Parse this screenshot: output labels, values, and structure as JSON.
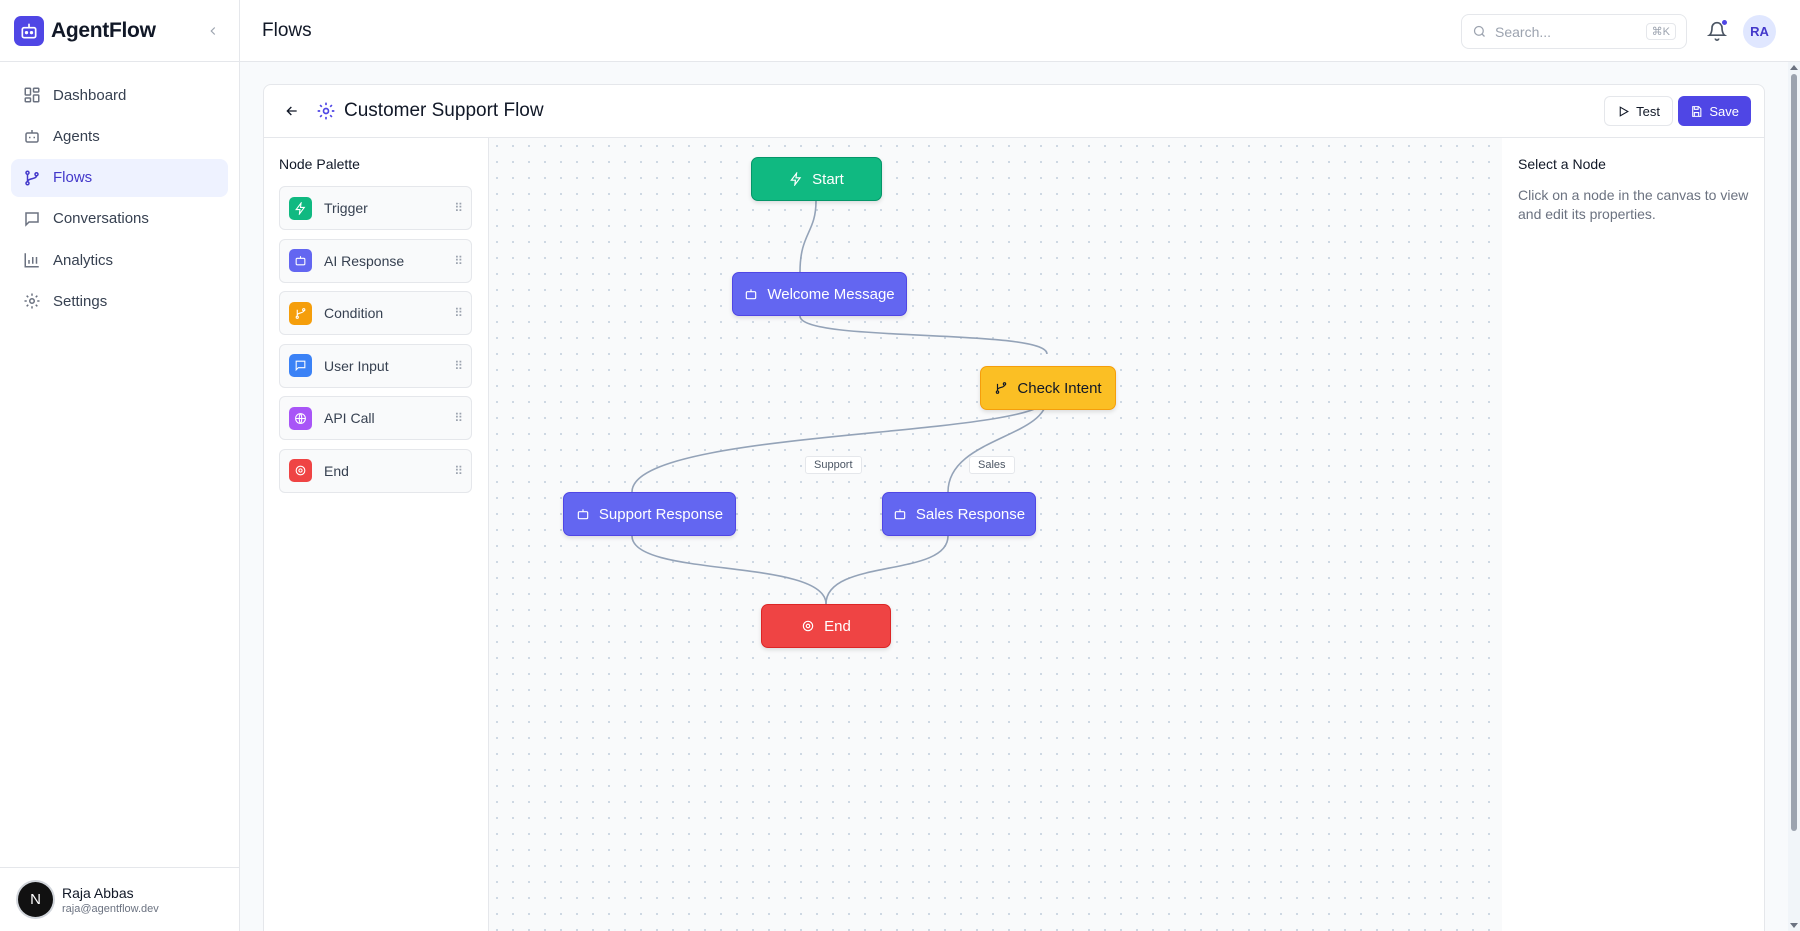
{
  "app": {
    "name": "AgentFlow"
  },
  "sidebar": {
    "items": [
      {
        "label": "Dashboard",
        "icon": "dashboard-icon",
        "active": false
      },
      {
        "label": "Agents",
        "icon": "bot-icon",
        "active": false
      },
      {
        "label": "Flows",
        "icon": "flow-icon",
        "active": true
      },
      {
        "label": "Conversations",
        "icon": "message-icon",
        "active": false
      },
      {
        "label": "Analytics",
        "icon": "chart-icon",
        "active": false
      },
      {
        "label": "Settings",
        "icon": "gear-icon",
        "active": false
      }
    ]
  },
  "user": {
    "initial": "N",
    "name": "Raja Abbas",
    "email": "raja@agentflow.dev"
  },
  "header": {
    "title": "Flows",
    "search_placeholder": "Search...",
    "shortcut": "⌘K",
    "avatar_initials": "RA",
    "has_notification": true
  },
  "editor": {
    "flow_name": "Customer Support Flow",
    "test_label": "Test",
    "save_label": "Save"
  },
  "palette": {
    "title": "Node Palette",
    "items": [
      {
        "label": "Trigger",
        "icon": "lightning-icon",
        "color": "#10b981"
      },
      {
        "label": "AI Response",
        "icon": "bot-icon",
        "color": "#6366f1"
      },
      {
        "label": "Condition",
        "icon": "branch-icon",
        "color": "#f59e0b"
      },
      {
        "label": "User Input",
        "icon": "message-icon",
        "color": "#3b82f6"
      },
      {
        "label": "API Call",
        "icon": "globe-icon",
        "color": "#a855f7"
      },
      {
        "label": "End",
        "icon": "target-icon",
        "color": "#ef4444"
      }
    ]
  },
  "canvas": {
    "nodes": [
      {
        "id": "start",
        "label": "Start",
        "type": "trigger",
        "color": "#10b981"
      },
      {
        "id": "welcome",
        "label": "Welcome Message",
        "type": "ai-response",
        "color": "#6366f1"
      },
      {
        "id": "check",
        "label": "Check Intent",
        "type": "condition",
        "color": "#fbbf24"
      },
      {
        "id": "support",
        "label": "Support Response",
        "type": "ai-response",
        "color": "#6366f1"
      },
      {
        "id": "sales",
        "label": "Sales Response",
        "type": "ai-response",
        "color": "#6366f1"
      },
      {
        "id": "end",
        "label": "End",
        "type": "end",
        "color": "#ef4444"
      }
    ],
    "edge_labels": {
      "support": "Support",
      "sales": "Sales"
    }
  },
  "properties": {
    "title": "Select a Node",
    "description": "Click on a node in the canvas to view and edit its properties."
  }
}
